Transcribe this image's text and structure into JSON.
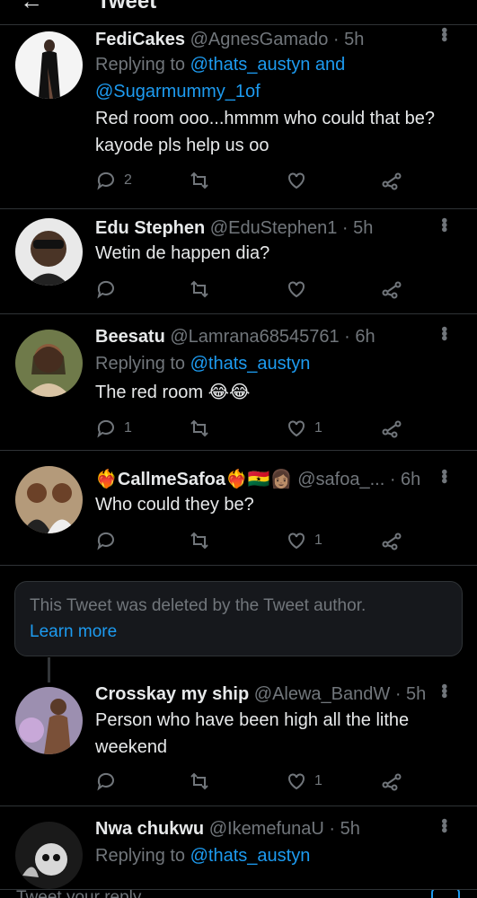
{
  "header": {
    "back_icon": "arrow-left-icon",
    "title": "Tweet"
  },
  "tweets": [
    {
      "name": "FediCakes",
      "handle": "@AgnesGamado",
      "time": "· 5h",
      "reply_prefix": "Replying to",
      "reply_links": "@thats_austyn and @Sugarmummy_1of",
      "text": "Red room ooo...hmmm who could that be? kayode pls help us oo",
      "replies": "2",
      "retweets": "",
      "likes": ""
    },
    {
      "name": "Edu Stephen",
      "handle": "@EduStephen1",
      "time": "· 5h",
      "text": "Wetin de happen dia?",
      "replies": "",
      "retweets": "",
      "likes": ""
    },
    {
      "name": "Beesatu",
      "handle": "@Lamrana68545761",
      "time": "· 6h",
      "reply_prefix": "Replying to",
      "reply_links": "@thats_austyn",
      "text": "The red room 😂😂",
      "replies": "1",
      "retweets": "",
      "likes": "1"
    },
    {
      "name": "❤️‍🔥CallmeSafoa❤️‍🔥🇬🇭👩🏽",
      "handle": "@safoa_...",
      "time": "· 6h",
      "text": "Who could they be?",
      "replies": "",
      "retweets": "",
      "likes": "1"
    },
    {
      "name": "Crosskay my ship",
      "handle": "@Alewa_BandW",
      "time": "· 5h",
      "text": "Person who have been high all the lithe weekend",
      "replies": "",
      "retweets": "",
      "likes": "1"
    },
    {
      "name": "Nwa chukwu",
      "handle": "@IkemefunaU",
      "time": "· 5h",
      "reply_prefix": "Replying to",
      "reply_links": "@thats_austyn"
    }
  ],
  "deleted": {
    "text": "This Tweet was deleted by the Tweet author.",
    "link": "Learn more"
  },
  "reply_bar": {
    "placeholder": "Tweet your reply",
    "camera_icon": "camera-icon"
  },
  "colors": {
    "background": "#000000",
    "accent": "#1d9bf0",
    "muted": "#71767b",
    "divider": "#2f3336"
  }
}
